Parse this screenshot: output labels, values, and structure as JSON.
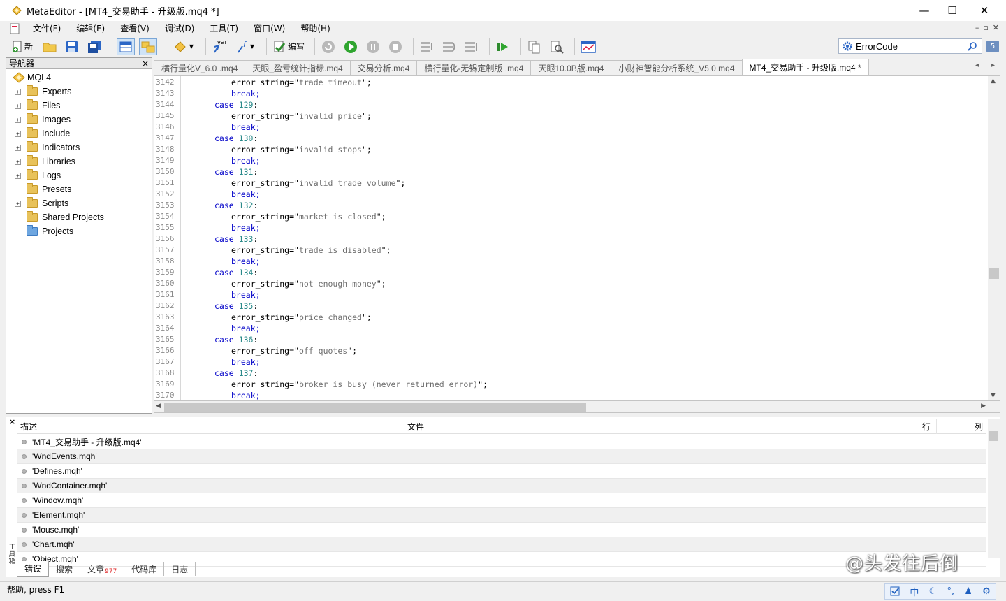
{
  "window": {
    "title": "MetaEditor - [MT4_交易助手 - 升级版.mq4 *]",
    "minimize": "—",
    "maximize": "☐",
    "close": "✕"
  },
  "menu": [
    "文件(F)",
    "编辑(E)",
    "查看(V)",
    "调试(D)",
    "工具(T)",
    "窗口(W)",
    "帮助(H)"
  ],
  "mdi_controls": [
    "–",
    "▫",
    "✕"
  ],
  "toolbar": {
    "new_label": "新",
    "compile_label": "编写",
    "var_label": "var",
    "search_value": "ErrorCode",
    "search_badge": "5"
  },
  "navigator": {
    "title": "导航器",
    "close": "×",
    "root": "MQL4",
    "items": [
      {
        "label": "Experts",
        "expandable": true
      },
      {
        "label": "Files",
        "expandable": true
      },
      {
        "label": "Images",
        "expandable": true
      },
      {
        "label": "Include",
        "expandable": true
      },
      {
        "label": "Indicators",
        "expandable": true
      },
      {
        "label": "Libraries",
        "expandable": true
      },
      {
        "label": "Logs",
        "expandable": true
      },
      {
        "label": "Presets",
        "expandable": false
      },
      {
        "label": "Scripts",
        "expandable": true
      },
      {
        "label": "Shared Projects",
        "expandable": false
      },
      {
        "label": "Projects",
        "expandable": false
      }
    ]
  },
  "tabs": [
    {
      "label": "横行量化V_6.0 .mq4",
      "active": false
    },
    {
      "label": "天眼_盈亏统计指标.mq4",
      "active": false
    },
    {
      "label": "交易分析.mq4",
      "active": false
    },
    {
      "label": "横行量化-无锡定制版 .mq4",
      "active": false
    },
    {
      "label": "天眼10.0B版.mq4",
      "active": false
    },
    {
      "label": "小财神智能分析系统_V5.0.mq4",
      "active": false
    },
    {
      "label": "MT4_交易助手 - 升级版.mq4 *",
      "active": true
    }
  ],
  "tab_arrows": [
    "◂",
    "▸"
  ],
  "code_lines": [
    {
      "n": "3142",
      "kind": "assign",
      "text": "trade timeout"
    },
    {
      "n": "3143",
      "kind": "break"
    },
    {
      "n": "3144",
      "kind": "case",
      "num": "129"
    },
    {
      "n": "3145",
      "kind": "assign",
      "text": "invalid price"
    },
    {
      "n": "3146",
      "kind": "break"
    },
    {
      "n": "3147",
      "kind": "case",
      "num": "130"
    },
    {
      "n": "3148",
      "kind": "assign",
      "text": "invalid stops"
    },
    {
      "n": "3149",
      "kind": "break"
    },
    {
      "n": "3150",
      "kind": "case",
      "num": "131"
    },
    {
      "n": "3151",
      "kind": "assign",
      "text": "invalid trade volume"
    },
    {
      "n": "3152",
      "kind": "break"
    },
    {
      "n": "3153",
      "kind": "case",
      "num": "132"
    },
    {
      "n": "3154",
      "kind": "assign",
      "text": "market is closed"
    },
    {
      "n": "3155",
      "kind": "break"
    },
    {
      "n": "3156",
      "kind": "case",
      "num": "133"
    },
    {
      "n": "3157",
      "kind": "assign",
      "text": "trade is disabled"
    },
    {
      "n": "3158",
      "kind": "break"
    },
    {
      "n": "3159",
      "kind": "case",
      "num": "134"
    },
    {
      "n": "3160",
      "kind": "assign",
      "text": "not enough money"
    },
    {
      "n": "3161",
      "kind": "break"
    },
    {
      "n": "3162",
      "kind": "case",
      "num": "135"
    },
    {
      "n": "3163",
      "kind": "assign",
      "text": "price changed"
    },
    {
      "n": "3164",
      "kind": "break"
    },
    {
      "n": "3165",
      "kind": "case",
      "num": "136"
    },
    {
      "n": "3166",
      "kind": "assign",
      "text": "off quotes"
    },
    {
      "n": "3167",
      "kind": "break"
    },
    {
      "n": "3168",
      "kind": "case",
      "num": "137"
    },
    {
      "n": "3169",
      "kind": "assign",
      "text": "broker is busy (never returned error)"
    },
    {
      "n": "3170",
      "kind": "break"
    }
  ],
  "code_tokens": {
    "var": "error_string=",
    "break": "break;",
    "case": "case"
  },
  "scroll_arrows": {
    "up": "▲",
    "down": "▼",
    "left": "◀",
    "right": "▶"
  },
  "errors": {
    "close": "×",
    "side_label": "工具箱",
    "columns": {
      "desc": "描述",
      "file": "文件",
      "line": "行",
      "col": "列"
    },
    "rows": [
      "'MT4_交易助手 - 升级版.mq4'",
      "'WndEvents.mqh'",
      "'Defines.mqh'",
      "'WndContainer.mqh'",
      "'Window.mqh'",
      "'Element.mqh'",
      "'Mouse.mqh'",
      "'Chart.mqh'",
      "'Object.mqh'"
    ]
  },
  "bottom_tabs": [
    {
      "label": "错误",
      "active": true,
      "badge": ""
    },
    {
      "label": "搜索",
      "active": false,
      "badge": ""
    },
    {
      "label": "文章",
      "active": false,
      "badge": "977"
    },
    {
      "label": "代码库",
      "active": false,
      "badge": ""
    },
    {
      "label": "日志",
      "active": false,
      "badge": ""
    }
  ],
  "status": "帮助, press F1",
  "watermark": "@头发往后倒",
  "ime": [
    "中",
    "☾",
    "°,",
    "♟",
    "⚙"
  ],
  "colors": {
    "keyword": "#0000c8",
    "string": "#6e6e6e",
    "number": "#2a8a8a",
    "active_tab": "#ffffff"
  }
}
